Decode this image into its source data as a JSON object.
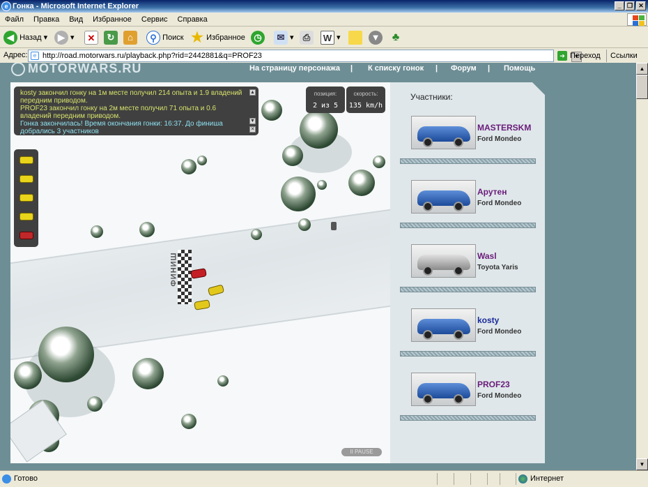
{
  "window": {
    "title": "Гонка - Microsoft Internet Explorer",
    "min": "_",
    "max": "❐",
    "close": "✕"
  },
  "menu": [
    "Файл",
    "Правка",
    "Вид",
    "Избранное",
    "Сервис",
    "Справка"
  ],
  "toolbar": {
    "back_label": "Назад",
    "search_label": "Поиск",
    "favorites_label": "Избранное"
  },
  "address": {
    "label": "Адрес:",
    "url": "http://road.motorwars.ru/playback.php?rid=2442881&q=PROF23",
    "go_label": "Переход",
    "links_label": "Ссылки"
  },
  "site": {
    "logo": "MOTORWARS.RU",
    "nav": [
      "На страницу персонажа",
      "К списку гонок",
      "Форум",
      "Помощь"
    ],
    "nav_sep": "|"
  },
  "game": {
    "messages": [
      "kosty закончил гонку на 1м месте получил 214 опыта и 1.9 владений передним приводом.",
      "PROF23 закончил гонку на 2м месте получил 71 опыта и 0.6 владений передним приводом.",
      "Гонка закончилась! Время окончания гонки: 16:37. До финиша добрались 3 участников"
    ],
    "position_label": "позиция:",
    "position_value": "2 из 5",
    "speed_label": "скорость:",
    "speed_value": "135 km/h",
    "finish_label": "ФИНИШ",
    "pause_label": "II PAUSE"
  },
  "participants": {
    "title": "Участники:",
    "items": [
      {
        "name": "MASTERSKM",
        "car": "Ford Mondeo"
      },
      {
        "name": "Арутен",
        "car": "Ford Mondeo"
      },
      {
        "name": "Wasl",
        "car": "Toyota Yaris"
      },
      {
        "name": "kosty",
        "car": "Ford Mondeo"
      },
      {
        "name": "PROF23",
        "car": "Ford Mondeo"
      }
    ]
  },
  "status": {
    "text": "Готово",
    "zone": "Интернет"
  }
}
